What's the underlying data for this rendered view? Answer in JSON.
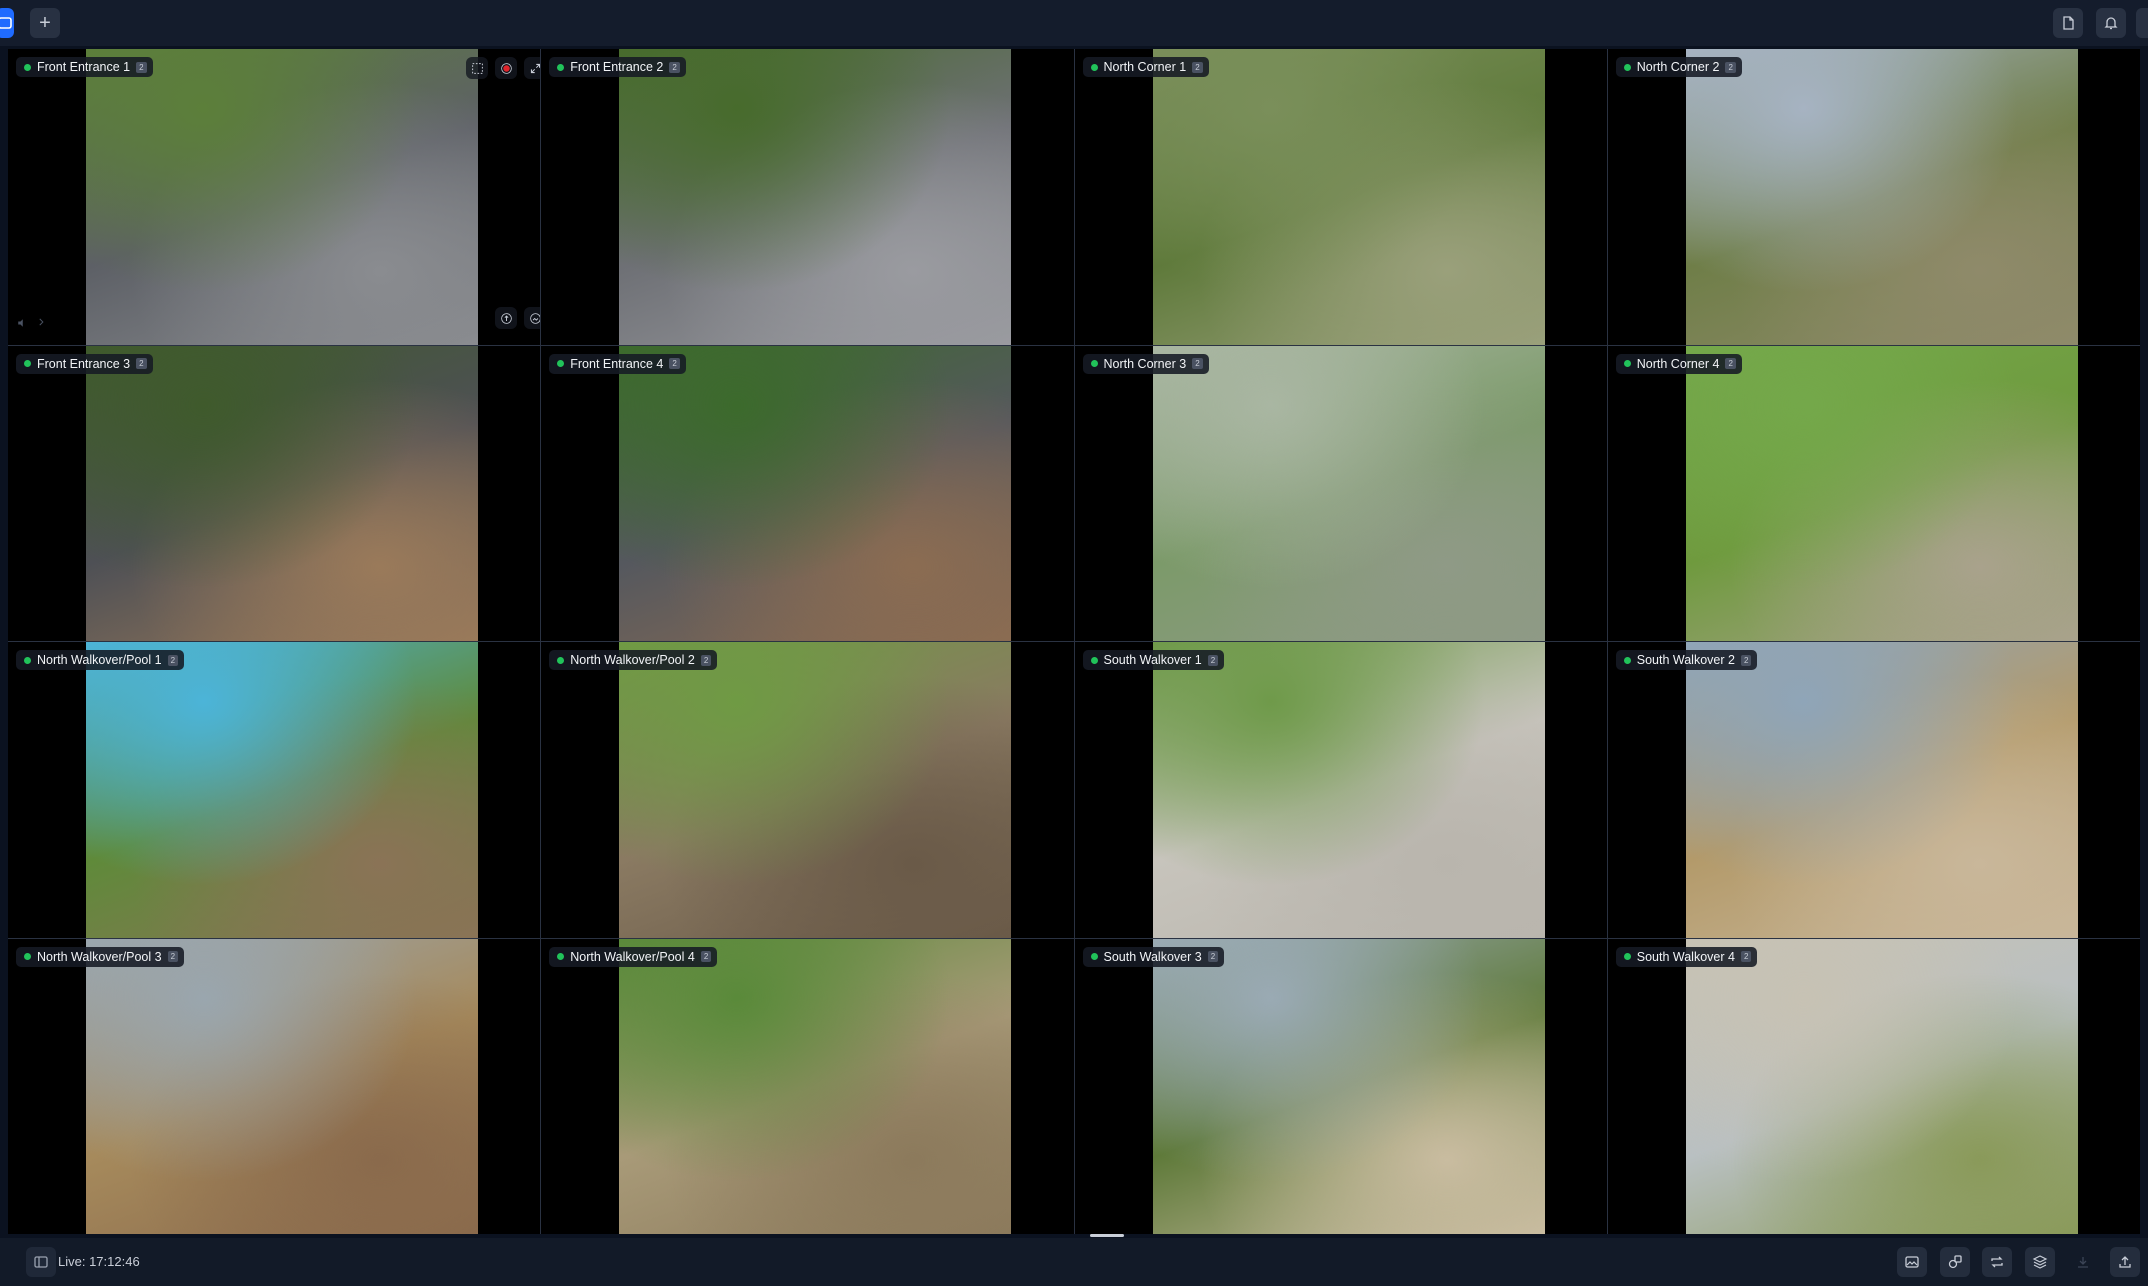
{
  "topbar": {
    "add_label": "+"
  },
  "cameras": [
    {
      "name": "Front Entrance 1",
      "badge": "2",
      "palette": [
        "#5c7f3a",
        "#5d6066",
        "#8a8c90"
      ]
    },
    {
      "name": "Front Entrance 2",
      "badge": "2",
      "palette": [
        "#476b2c",
        "#6e7075",
        "#9a9ba0"
      ]
    },
    {
      "name": "North Corner 1",
      "badge": "2",
      "palette": [
        "#7a8f5a",
        "#5f7a3b",
        "#9aa07b"
      ]
    },
    {
      "name": "North Corner 2",
      "badge": "2",
      "palette": [
        "#a6b3c2",
        "#6f7e48",
        "#8f8a6a"
      ]
    },
    {
      "name": "Front Entrance 3",
      "badge": "2",
      "palette": [
        "#3f5a2c",
        "#4e5055",
        "#9a7a5a"
      ]
    },
    {
      "name": "Front Entrance 4",
      "badge": "2",
      "palette": [
        "#3c6a2c",
        "#55585e",
        "#8b6c52"
      ]
    },
    {
      "name": "North Corner 3",
      "badge": "2",
      "palette": [
        "#a9b6a2",
        "#7c9a6a",
        "#8f9a86"
      ]
    },
    {
      "name": "North Corner 4",
      "badge": "2",
      "palette": [
        "#74a84a",
        "#6f9a3e",
        "#a9a28c"
      ]
    },
    {
      "name": "North Walkover/Pool 1",
      "badge": "2",
      "palette": [
        "#4cb4d8",
        "#5f8a3a",
        "#8a7356"
      ]
    },
    {
      "name": "North Walkover/Pool 2",
      "badge": "2",
      "palette": [
        "#6f9a44",
        "#8a7a62",
        "#6a5a48"
      ]
    },
    {
      "name": "South Walkover 1",
      "badge": "2",
      "palette": [
        "#6f9a4a",
        "#c7c4bc",
        "#b9b5ad"
      ]
    },
    {
      "name": "South Walkover 2",
      "badge": "2",
      "palette": [
        "#8fa5b8",
        "#b39a6a",
        "#c9b79a"
      ]
    },
    {
      "name": "North Walkover/Pool 3",
      "badge": "2",
      "palette": [
        "#9aa6ae",
        "#a68a5c",
        "#8a6a4c"
      ]
    },
    {
      "name": "North Walkover/Pool 4",
      "badge": "2",
      "palette": [
        "#5a8a3a",
        "#a89a78",
        "#8c7a5c"
      ]
    },
    {
      "name": "South Walkover 3",
      "badge": "2",
      "palette": [
        "#9aaab4",
        "#5f7a3a",
        "#c9bca0"
      ]
    },
    {
      "name": "South Walkover 4",
      "badge": "2",
      "palette": [
        "#c7c2b4",
        "#b9c0c2",
        "#8a9a5a"
      ]
    }
  ],
  "status": {
    "live_time": "Live: 17:12:46"
  }
}
